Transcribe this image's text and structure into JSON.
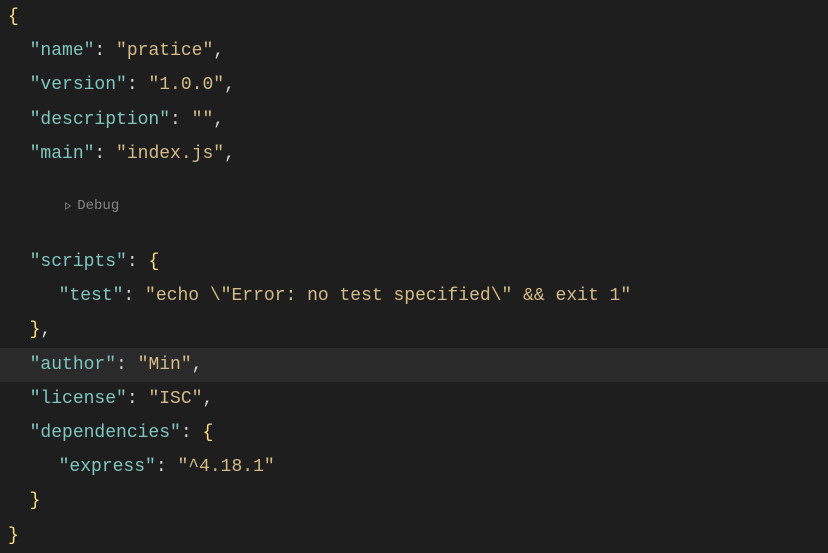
{
  "code": {
    "brace_open": "{",
    "brace_close": "}",
    "bracket_open": "{",
    "bracket_close": "}",
    "comma": ",",
    "colon": ":",
    "quote": "\"",
    "indent1": "  ",
    "indent2": "    ",
    "keys": {
      "name": "\"name\"",
      "version": "\"version\"",
      "description": "\"description\"",
      "main": "\"main\"",
      "scripts": "\"scripts\"",
      "test": "\"test\"",
      "author": "\"author\"",
      "license": "\"license\"",
      "dependencies": "\"dependencies\"",
      "express": "\"express\""
    },
    "values": {
      "name": "\"pratice\"",
      "version": "\"1.0.0\"",
      "description": "\"\"",
      "main": "\"index.js\"",
      "test_part1": "\"echo ",
      "test_esc1": "\\\"",
      "test_part2": "Error: no test specified",
      "test_esc2": "\\\"",
      "test_part3": " && exit 1\"",
      "author": "\"Min\"",
      "license": "\"ISC\"",
      "express": "\"^4.18.1\""
    }
  },
  "codelens": {
    "debug": "Debug"
  }
}
